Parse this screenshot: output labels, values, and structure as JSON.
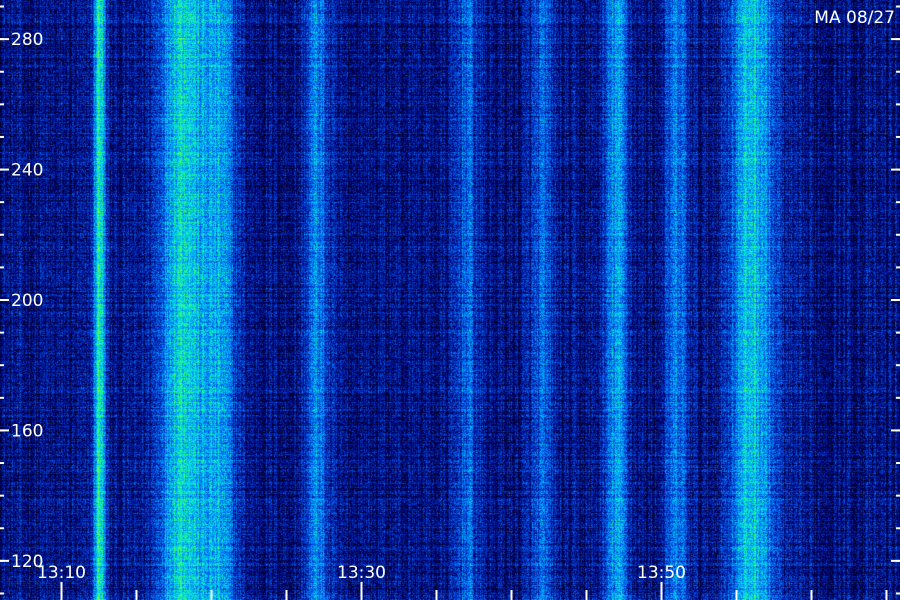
{
  "chart_data": {
    "type": "heatmap",
    "title": "MA 08/27",
    "colormap": [
      "#000010",
      "#000060",
      "#0030c0",
      "#0080ff",
      "#00e0e0",
      "#40ff60",
      "#c0ff20"
    ],
    "background_color": "#000000",
    "tick_color": "#ffffff",
    "y_axis": {
      "ticks": [
        {
          "value": 120,
          "label": "120"
        },
        {
          "value": 160,
          "label": "160"
        },
        {
          "value": 200,
          "label": "200"
        },
        {
          "value": 240,
          "label": "240"
        },
        {
          "value": 280,
          "label": "280"
        }
      ],
      "ylim": [
        108,
        292
      ],
      "minor_step": 10
    },
    "x_axis": {
      "ticks": [
        {
          "value": "13:10",
          "minutes": 790,
          "label": "13:10"
        },
        {
          "value": "13:30",
          "minutes": 810,
          "label": "13:30"
        },
        {
          "value": "13:50",
          "minutes": 830,
          "label": "13:50"
        }
      ],
      "xlim_minutes": [
        785.9,
        845.9
      ],
      "minor_step_minutes": 5
    },
    "emission_bands": [
      {
        "start": "13:12",
        "end": "13:13",
        "intensity": 0.95
      },
      {
        "start": "13:16",
        "end": "13:20",
        "intensity": 0.85
      },
      {
        "start": "13:19",
        "end": "13:22",
        "intensity": 0.55
      },
      {
        "start": "13:26",
        "end": "13:28",
        "intensity": 0.5
      },
      {
        "start": "13:36",
        "end": "13:38",
        "intensity": 0.4
      },
      {
        "start": "13:41",
        "end": "13:43",
        "intensity": 0.35
      },
      {
        "start": "13:46",
        "end": "13:48",
        "intensity": 0.6
      },
      {
        "start": "13:50",
        "end": "13:52",
        "intensity": 0.45
      },
      {
        "start": "13:54",
        "end": "13:58",
        "intensity": 0.75
      }
    ]
  }
}
